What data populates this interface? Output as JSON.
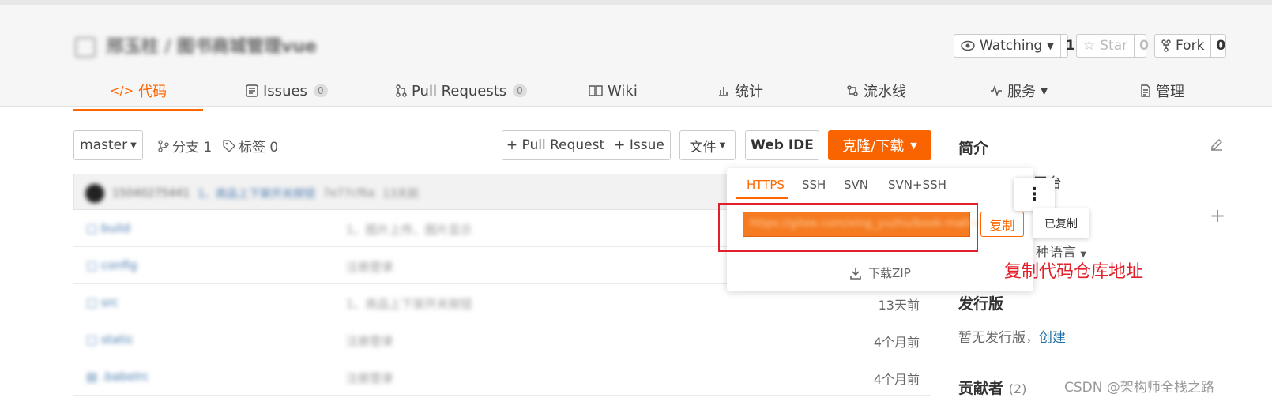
{
  "repo": {
    "owner": "邢玉柱",
    "separator": " / ",
    "name": "图书商城管理vue"
  },
  "actions": {
    "watching": {
      "label": "Watching",
      "count": "1"
    },
    "star": {
      "label": "Star",
      "count": "0"
    },
    "fork": {
      "label": "Fork",
      "count": "0"
    }
  },
  "tabs": [
    {
      "icon": "</>",
      "label": "代码"
    },
    {
      "label": "Issues",
      "badge": "0"
    },
    {
      "label": "Pull Requests",
      "badge": "0"
    },
    {
      "label": "Wiki"
    },
    {
      "label": "统计"
    },
    {
      "label": "流水线"
    },
    {
      "label": "服务"
    },
    {
      "label": "管理"
    }
  ],
  "toolbar": {
    "branch": "master",
    "branches": "分支 1",
    "tags": "标签 0",
    "pull_request": "+ Pull Request",
    "issue": "+ Issue",
    "file": "文件",
    "web_ide": "Web IDE",
    "clone": "克隆/下载"
  },
  "commit": {
    "author": "15040275441",
    "message": "1、商品上下架开关按钮",
    "hash": "7e77cf6a",
    "time": "13天前"
  },
  "files": [
    {
      "name": "build",
      "message": "1、图片上传、图片显示",
      "time": ""
    },
    {
      "name": "config",
      "message": "注册登录",
      "time": ""
    },
    {
      "name": "src",
      "message": "1、商品上下架开关按钮",
      "time": "13天前"
    },
    {
      "name": "static",
      "message": "注册登录",
      "time": "4个月前"
    },
    {
      "name": ".babelrc",
      "message": "注册登录",
      "time": "4个月前"
    }
  ],
  "sidebar": {
    "intro": "简介",
    "platform_text": "平台",
    "languages": "种语言",
    "releases": "发行版",
    "no_release": "暂无发行版，",
    "create": "创建",
    "contributors": "贡献者",
    "contributors_count": "(2)"
  },
  "dropdown": {
    "tabs": [
      "HTTPS",
      "SSH",
      "SVN",
      "SVN+SSH"
    ],
    "url": "https://gitee.com/xing_yuzhu/book-mall-vue.git",
    "copy": "复制",
    "copied": "已复制",
    "download_zip": "下载ZIP"
  },
  "annotation": "复制代码仓库地址",
  "watermark": "CSDN @架构师全栈之路",
  "colors": {
    "accent": "#fa6400",
    "annotation": "#e0202a",
    "link": "#1d6fa5"
  }
}
